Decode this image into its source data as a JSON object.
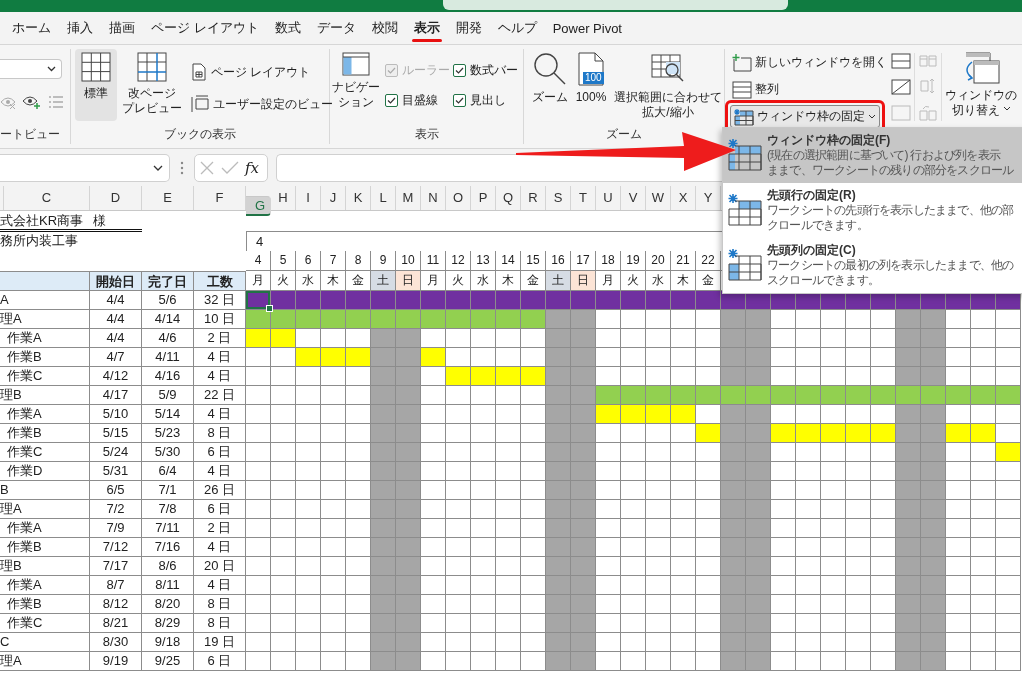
{
  "ribbon_tabs": [
    {
      "label": "ホーム",
      "selected": false
    },
    {
      "label": "挿入",
      "selected": false
    },
    {
      "label": "描画",
      "selected": false
    },
    {
      "label": "ページ レイアウト",
      "selected": false
    },
    {
      "label": "数式",
      "selected": false
    },
    {
      "label": "データ",
      "selected": false
    },
    {
      "label": "校閲",
      "selected": false
    },
    {
      "label": "表示",
      "selected": true
    },
    {
      "label": "開発",
      "selected": false
    },
    {
      "label": "ヘルプ",
      "selected": false
    },
    {
      "label": "Power Pivot",
      "selected": false
    }
  ],
  "ribbon": {
    "sheet_view": {
      "label": "ートビュー"
    },
    "workbook_views": {
      "label": "ブックの表示",
      "buttons": [
        {
          "kind": "normal",
          "lines": [
            "標準"
          ],
          "selected": true
        },
        {
          "kind": "page-break",
          "lines": [
            "改ページ",
            "プレビュー"
          ],
          "selected": false
        }
      ],
      "small_buttons": [
        {
          "kind": "page-layout",
          "label": "ページ レイアウト"
        },
        {
          "kind": "custom-views",
          "label": "ユーザー設定のビュー"
        }
      ]
    },
    "show": {
      "label": "表示",
      "navigation": [
        "ナビゲー",
        "ション"
      ],
      "checkboxes": [
        {
          "label": "ルーラー",
          "checked": true,
          "disabled": true
        },
        {
          "label": "数式バー",
          "checked": true,
          "disabled": false
        },
        {
          "label": "目盛線",
          "checked": true,
          "disabled": false
        },
        {
          "label": "見出し",
          "checked": true,
          "disabled": false
        }
      ]
    },
    "zoom": {
      "label": "ズーム",
      "buttons": [
        {
          "kind": "zoom",
          "lines": [
            "ズーム"
          ]
        },
        {
          "kind": "hundred",
          "icon_text": "100",
          "lines": [
            "100%"
          ]
        },
        {
          "kind": "fit",
          "lines": [
            "選択範囲に合わせて",
            "拡大/縮小"
          ]
        }
      ]
    },
    "window": {
      "buttons": [
        {
          "kind": "new-window",
          "label": "新しいウィンドウを開く",
          "highlighted": false
        },
        {
          "kind": "arrange",
          "label": "整列",
          "highlighted": false
        },
        {
          "kind": "freeze",
          "label": "ウィンドウ枠の固定",
          "highlighted": true
        }
      ],
      "switch": [
        "ウィンドウの",
        "切り替え"
      ]
    }
  },
  "formula_bar": {
    "function_label": "fx"
  },
  "sheet": {
    "left_columns": [
      "C",
      "D",
      "E",
      "F"
    ],
    "client": "式会社KR商事",
    "honorific": "様",
    "project": "務所内装工事",
    "month": "4",
    "headers": [
      "開始日",
      "完了日",
      "工数"
    ],
    "day_columns": [
      {
        "letter": "G",
        "date": "4",
        "weekday": "月",
        "kind": "weekday",
        "selected": true
      },
      {
        "letter": "H",
        "date": "5",
        "weekday": "火",
        "kind": "weekday",
        "selected": false
      },
      {
        "letter": "I",
        "date": "6",
        "weekday": "水",
        "kind": "weekday",
        "selected": false
      },
      {
        "letter": "J",
        "date": "7",
        "weekday": "木",
        "kind": "weekday",
        "selected": false
      },
      {
        "letter": "K",
        "date": "8",
        "weekday": "金",
        "kind": "weekday",
        "selected": false
      },
      {
        "letter": "L",
        "date": "9",
        "weekday": "土",
        "kind": "saturday",
        "selected": false
      },
      {
        "letter": "M",
        "date": "10",
        "weekday": "日",
        "kind": "sunday",
        "selected": false
      },
      {
        "letter": "N",
        "date": "11",
        "weekday": "月",
        "kind": "weekday",
        "selected": false
      },
      {
        "letter": "O",
        "date": "12",
        "weekday": "火",
        "kind": "weekday",
        "selected": false
      },
      {
        "letter": "P",
        "date": "13",
        "weekday": "水",
        "kind": "weekday",
        "selected": false
      },
      {
        "letter": "Q",
        "date": "14",
        "weekday": "木",
        "kind": "weekday",
        "selected": false
      },
      {
        "letter": "R",
        "date": "15",
        "weekday": "金",
        "kind": "weekday",
        "selected": false
      },
      {
        "letter": "S",
        "date": "16",
        "weekday": "土",
        "kind": "saturday",
        "selected": false
      },
      {
        "letter": "T",
        "date": "17",
        "weekday": "日",
        "kind": "sunday",
        "selected": false
      },
      {
        "letter": "U",
        "date": "18",
        "weekday": "月",
        "kind": "weekday",
        "selected": false
      },
      {
        "letter": "V",
        "date": "19",
        "weekday": "火",
        "kind": "weekday",
        "selected": false
      },
      {
        "letter": "W",
        "date": "20",
        "weekday": "水",
        "kind": "weekday",
        "selected": false
      },
      {
        "letter": "X",
        "date": "21",
        "weekday": "木",
        "kind": "weekday",
        "selected": false
      },
      {
        "letter": "Y",
        "date": "22",
        "weekday": "金",
        "kind": "weekday",
        "selected": false
      },
      {
        "kind": "saturday"
      },
      {
        "kind": "sunday"
      },
      {
        "kind": "weekday"
      },
      {
        "kind": "weekday"
      },
      {
        "kind": "weekday"
      },
      {
        "kind": "weekday"
      },
      {
        "kind": "weekday"
      },
      {
        "kind": "saturday"
      },
      {
        "kind": "sunday"
      },
      {
        "kind": "weekday"
      },
      {
        "kind": "weekday"
      },
      {
        "kind": "weekday"
      }
    ],
    "tasks": [
      {
        "name": "A",
        "kind": "phase",
        "start": "4/4",
        "end": "5/6",
        "days": "32 日",
        "selected": true,
        "cells": [
          {
            "color": "#7030a0"
          },
          {
            "color": "#7030a0"
          },
          {
            "color": "#7030a0"
          },
          {
            "color": "#7030a0"
          },
          {
            "color": "#7030a0"
          },
          {
            "color": "#7030a0"
          },
          {
            "color": "#7030a0"
          },
          {
            "color": "#7030a0"
          },
          {
            "color": "#7030a0"
          },
          {
            "color": "#7030a0"
          },
          {
            "color": "#7030a0"
          },
          {
            "color": "#7030a0"
          },
          {
            "color": "#7030a0"
          },
          {
            "color": "#7030a0"
          },
          {
            "color": "#7030a0"
          },
          {
            "color": "#7030a0"
          },
          {
            "color": "#7030a0"
          },
          {
            "color": "#7030a0"
          },
          {
            "color": "#7030a0"
          },
          {
            "color": "#7030a0"
          },
          {
            "color": "#7030a0"
          },
          {
            "color": "#7030a0"
          },
          {
            "color": "#7030a0"
          },
          {
            "color": "#7030a0"
          },
          {
            "color": "#7030a0"
          },
          {
            "color": "#7030a0"
          },
          {
            "color": "#7030a0"
          },
          {
            "color": "#7030a0"
          },
          {
            "color": "#7030a0"
          },
          {
            "color": "#7030a0"
          },
          {
            "color": "#7030a0"
          }
        ]
      },
      {
        "name": "理A",
        "kind": "phase",
        "start": "4/4",
        "end": "4/14",
        "days": "10 日",
        "selected": false,
        "cells": [
          {
            "color": "#92d050"
          },
          {
            "color": "#92d050"
          },
          {
            "color": "#92d050"
          },
          {
            "color": "#92d050"
          },
          {
            "color": "#92d050"
          },
          {
            "color": "#92d050"
          },
          {
            "color": "#92d050"
          },
          {
            "color": "#92d050"
          },
          {
            "color": "#92d050"
          },
          {
            "color": "#92d050"
          },
          {
            "color": "#92d050"
          },
          {
            "color": "#92d050"
          },
          {
            "color": "#a6a6a6"
          },
          {
            "color": "#a6a6a6"
          },
          {
            "color": "#ffffff"
          },
          {
            "color": "#ffffff"
          },
          {
            "color": "#ffffff"
          },
          {
            "color": "#ffffff"
          },
          {
            "color": "#ffffff"
          },
          {
            "color": "#a6a6a6"
          },
          {
            "color": "#a6a6a6"
          },
          {
            "color": "#ffffff"
          },
          {
            "color": "#ffffff"
          },
          {
            "color": "#ffffff"
          },
          {
            "color": "#ffffff"
          },
          {
            "color": "#ffffff"
          },
          {
            "color": "#a6a6a6"
          },
          {
            "color": "#a6a6a6"
          },
          {
            "color": "#ffffff"
          },
          {
            "color": "#ffffff"
          },
          {
            "color": "#ffffff"
          }
        ]
      },
      {
        "name": "作業A",
        "kind": "step",
        "start": "4/4",
        "end": "4/6",
        "days": "2 日",
        "selected": false,
        "cells": [
          {
            "color": "#ffff00"
          },
          {
            "color": "#ffff00"
          },
          {
            "color": "#ffffff"
          },
          {
            "color": "#ffffff"
          },
          {
            "color": "#ffffff"
          },
          {
            "color": "#a6a6a6"
          },
          {
            "color": "#a6a6a6"
          },
          {
            "color": "#ffffff"
          },
          {
            "color": "#ffffff"
          },
          {
            "color": "#ffffff"
          },
          {
            "color": "#ffffff"
          },
          {
            "color": "#ffffff"
          },
          {
            "color": "#a6a6a6"
          },
          {
            "color": "#a6a6a6"
          },
          {
            "color": "#ffffff"
          },
          {
            "color": "#ffffff"
          },
          {
            "color": "#ffffff"
          },
          {
            "color": "#ffffff"
          },
          {
            "color": "#ffffff"
          },
          {
            "color": "#a6a6a6"
          },
          {
            "color": "#a6a6a6"
          },
          {
            "color": "#ffffff"
          },
          {
            "color": "#ffffff"
          },
          {
            "color": "#ffffff"
          },
          {
            "color": "#ffffff"
          },
          {
            "color": "#ffffff"
          },
          {
            "color": "#a6a6a6"
          },
          {
            "color": "#a6a6a6"
          },
          {
            "color": "#ffffff"
          },
          {
            "color": "#ffffff"
          },
          {
            "color": "#ffffff"
          }
        ]
      },
      {
        "name": "作業B",
        "kind": "step",
        "start": "4/7",
        "end": "4/11",
        "days": "4 日",
        "selected": false,
        "cells": [
          {
            "color": "#ffffff"
          },
          {
            "color": "#ffffff"
          },
          {
            "color": "#ffff00"
          },
          {
            "color": "#ffff00"
          },
          {
            "color": "#ffff00"
          },
          {
            "color": "#a6a6a6"
          },
          {
            "color": "#a6a6a6"
          },
          {
            "color": "#ffff00"
          },
          {
            "color": "#ffffff"
          },
          {
            "color": "#ffffff"
          },
          {
            "color": "#ffffff"
          },
          {
            "color": "#ffffff"
          },
          {
            "color": "#a6a6a6"
          },
          {
            "color": "#a6a6a6"
          },
          {
            "color": "#ffffff"
          },
          {
            "color": "#ffffff"
          },
          {
            "color": "#ffffff"
          },
          {
            "color": "#ffffff"
          },
          {
            "color": "#ffffff"
          },
          {
            "color": "#a6a6a6"
          },
          {
            "color": "#a6a6a6"
          },
          {
            "color": "#ffffff"
          },
          {
            "color": "#ffffff"
          },
          {
            "color": "#ffffff"
          },
          {
            "color": "#ffffff"
          },
          {
            "color": "#ffffff"
          },
          {
            "color": "#a6a6a6"
          },
          {
            "color": "#a6a6a6"
          },
          {
            "color": "#ffffff"
          },
          {
            "color": "#ffffff"
          },
          {
            "color": "#ffffff"
          }
        ]
      },
      {
        "name": "作業C",
        "kind": "step",
        "start": "4/12",
        "end": "4/16",
        "days": "4 日",
        "selected": false,
        "cells": [
          {
            "color": "#ffffff"
          },
          {
            "color": "#ffffff"
          },
          {
            "color": "#ffffff"
          },
          {
            "color": "#ffffff"
          },
          {
            "color": "#ffffff"
          },
          {
            "color": "#a6a6a6"
          },
          {
            "color": "#a6a6a6"
          },
          {
            "color": "#ffffff"
          },
          {
            "color": "#ffff00"
          },
          {
            "color": "#ffff00"
          },
          {
            "color": "#ffff00"
          },
          {
            "color": "#ffff00"
          },
          {
            "color": "#a6a6a6"
          },
          {
            "color": "#a6a6a6"
          },
          {
            "color": "#ffffff"
          },
          {
            "color": "#ffffff"
          },
          {
            "color": "#ffffff"
          },
          {
            "color": "#ffffff"
          },
          {
            "color": "#ffffff"
          },
          {
            "color": "#a6a6a6"
          },
          {
            "color": "#a6a6a6"
          },
          {
            "color": "#ffffff"
          },
          {
            "color": "#ffffff"
          },
          {
            "color": "#ffffff"
          },
          {
            "color": "#ffffff"
          },
          {
            "color": "#ffffff"
          },
          {
            "color": "#a6a6a6"
          },
          {
            "color": "#a6a6a6"
          },
          {
            "color": "#ffffff"
          },
          {
            "color": "#ffffff"
          },
          {
            "color": "#ffffff"
          }
        ]
      },
      {
        "name": "理B",
        "kind": "phase",
        "start": "4/17",
        "end": "5/9",
        "days": "22 日",
        "selected": false,
        "cells": [
          {
            "color": "#ffffff"
          },
          {
            "color": "#ffffff"
          },
          {
            "color": "#ffffff"
          },
          {
            "color": "#ffffff"
          },
          {
            "color": "#ffffff"
          },
          {
            "color": "#a6a6a6"
          },
          {
            "color": "#a6a6a6"
          },
          {
            "color": "#ffffff"
          },
          {
            "color": "#ffffff"
          },
          {
            "color": "#ffffff"
          },
          {
            "color": "#ffffff"
          },
          {
            "color": "#ffffff"
          },
          {
            "color": "#a6a6a6"
          },
          {
            "color": "#a6a6a6"
          },
          {
            "color": "#92d050"
          },
          {
            "color": "#92d050"
          },
          {
            "color": "#92d050"
          },
          {
            "color": "#92d050"
          },
          {
            "color": "#92d050"
          },
          {
            "color": "#92d050"
          },
          {
            "color": "#92d050"
          },
          {
            "color": "#92d050"
          },
          {
            "color": "#92d050"
          },
          {
            "color": "#92d050"
          },
          {
            "color": "#92d050"
          },
          {
            "color": "#92d050"
          },
          {
            "color": "#92d050"
          },
          {
            "color": "#92d050"
          },
          {
            "color": "#92d050"
          },
          {
            "color": "#92d050"
          },
          {
            "color": "#92d050"
          }
        ]
      },
      {
        "name": "作業A",
        "kind": "step",
        "start": "5/10",
        "end": "5/14",
        "days": "4 日",
        "selected": false,
        "cells": [
          {
            "color": "#ffffff"
          },
          {
            "color": "#ffffff"
          },
          {
            "color": "#ffffff"
          },
          {
            "color": "#ffffff"
          },
          {
            "color": "#ffffff"
          },
          {
            "color": "#a6a6a6"
          },
          {
            "color": "#a6a6a6"
          },
          {
            "color": "#ffffff"
          },
          {
            "color": "#ffffff"
          },
          {
            "color": "#ffffff"
          },
          {
            "color": "#ffffff"
          },
          {
            "color": "#ffffff"
          },
          {
            "color": "#a6a6a6"
          },
          {
            "color": "#a6a6a6"
          },
          {
            "color": "#ffff00"
          },
          {
            "color": "#ffff00"
          },
          {
            "color": "#ffff00"
          },
          {
            "color": "#ffff00"
          },
          {
            "color": "#ffffff"
          },
          {
            "color": "#a6a6a6"
          },
          {
            "color": "#a6a6a6"
          },
          {
            "color": "#ffffff"
          },
          {
            "color": "#ffffff"
          },
          {
            "color": "#ffffff"
          },
          {
            "color": "#ffffff"
          },
          {
            "color": "#ffffff"
          },
          {
            "color": "#a6a6a6"
          },
          {
            "color": "#a6a6a6"
          },
          {
            "color": "#ffffff"
          },
          {
            "color": "#ffffff"
          },
          {
            "color": "#ffffff"
          }
        ]
      },
      {
        "name": "作業B",
        "kind": "step",
        "start": "5/15",
        "end": "5/23",
        "days": "8 日",
        "selected": false,
        "cells": [
          {
            "color": "#ffffff"
          },
          {
            "color": "#ffffff"
          },
          {
            "color": "#ffffff"
          },
          {
            "color": "#ffffff"
          },
          {
            "color": "#ffffff"
          },
          {
            "color": "#a6a6a6"
          },
          {
            "color": "#a6a6a6"
          },
          {
            "color": "#ffffff"
          },
          {
            "color": "#ffffff"
          },
          {
            "color": "#ffffff"
          },
          {
            "color": "#ffffff"
          },
          {
            "color": "#ffffff"
          },
          {
            "color": "#a6a6a6"
          },
          {
            "color": "#a6a6a6"
          },
          {
            "color": "#ffffff"
          },
          {
            "color": "#ffffff"
          },
          {
            "color": "#ffffff"
          },
          {
            "color": "#ffffff"
          },
          {
            "color": "#ffff00"
          },
          {
            "color": "#a6a6a6"
          },
          {
            "color": "#a6a6a6"
          },
          {
            "color": "#ffff00"
          },
          {
            "color": "#ffff00"
          },
          {
            "color": "#ffff00"
          },
          {
            "color": "#ffff00"
          },
          {
            "color": "#ffff00"
          },
          {
            "color": "#a6a6a6"
          },
          {
            "color": "#a6a6a6"
          },
          {
            "color": "#ffff00"
          },
          {
            "color": "#ffff00"
          },
          {
            "color": "#ffffff"
          }
        ]
      },
      {
        "name": "作業C",
        "kind": "step",
        "start": "5/24",
        "end": "5/30",
        "days": "6 日",
        "selected": false,
        "cells": [
          {
            "color": "#ffffff"
          },
          {
            "color": "#ffffff"
          },
          {
            "color": "#ffffff"
          },
          {
            "color": "#ffffff"
          },
          {
            "color": "#ffffff"
          },
          {
            "color": "#a6a6a6"
          },
          {
            "color": "#a6a6a6"
          },
          {
            "color": "#ffffff"
          },
          {
            "color": "#ffffff"
          },
          {
            "color": "#ffffff"
          },
          {
            "color": "#ffffff"
          },
          {
            "color": "#ffffff"
          },
          {
            "color": "#a6a6a6"
          },
          {
            "color": "#a6a6a6"
          },
          {
            "color": "#ffffff"
          },
          {
            "color": "#ffffff"
          },
          {
            "color": "#ffffff"
          },
          {
            "color": "#ffffff"
          },
          {
            "color": "#ffffff"
          },
          {
            "color": "#a6a6a6"
          },
          {
            "color": "#a6a6a6"
          },
          {
            "color": "#ffffff"
          },
          {
            "color": "#ffffff"
          },
          {
            "color": "#ffffff"
          },
          {
            "color": "#ffffff"
          },
          {
            "color": "#ffffff"
          },
          {
            "color": "#a6a6a6"
          },
          {
            "color": "#a6a6a6"
          },
          {
            "color": "#ffffff"
          },
          {
            "color": "#ffffff"
          },
          {
            "color": "#ffff00"
          }
        ]
      },
      {
        "name": "作業D",
        "kind": "step",
        "start": "5/31",
        "end": "6/4",
        "days": "4 日",
        "selected": false
      },
      {
        "name": "B",
        "kind": "phase",
        "start": "6/5",
        "end": "7/1",
        "days": "26 日",
        "selected": false
      },
      {
        "name": "理A",
        "kind": "phase",
        "start": "7/2",
        "end": "7/8",
        "days": "6 日",
        "selected": false
      },
      {
        "name": "作業A",
        "kind": "step",
        "start": "7/9",
        "end": "7/11",
        "days": "2 日",
        "selected": false
      },
      {
        "name": "作業B",
        "kind": "step",
        "start": "7/12",
        "end": "7/16",
        "days": "4 日",
        "selected": false
      },
      {
        "name": "理B",
        "kind": "phase",
        "start": "7/17",
        "end": "8/6",
        "days": "20 日",
        "selected": false
      },
      {
        "name": "作業A",
        "kind": "step",
        "start": "8/7",
        "end": "8/11",
        "days": "4 日",
        "selected": false
      },
      {
        "name": "作業B",
        "kind": "step",
        "start": "8/12",
        "end": "8/20",
        "days": "8 日",
        "selected": false
      },
      {
        "name": "作業C",
        "kind": "step",
        "start": "8/21",
        "end": "8/29",
        "days": "8 日",
        "selected": false
      },
      {
        "name": "C",
        "kind": "phase",
        "start": "8/30",
        "end": "9/18",
        "days": "19 日",
        "selected": false
      },
      {
        "name": "理A",
        "kind": "phase",
        "start": "9/19",
        "end": "9/25",
        "days": "6 日",
        "selected": false
      }
    ]
  },
  "freeze_menu": {
    "items": [
      {
        "kind": "panes",
        "title": "ウィンドウ枠の固定(F)",
        "lines": [
          "(現在の選択範囲に基づいて) 行および列を表示",
          "ままで、ワークシートの残りの部分をスクロール"
        ],
        "selected": true
      },
      {
        "kind": "top-row",
        "title": "先頭行の固定(R)",
        "lines": [
          "ワークシートの先頭行を表示したままで、他の部",
          "クロールできます。"
        ],
        "selected": false
      },
      {
        "kind": "first-column",
        "title": "先頭列の固定(C)",
        "lines": [
          "ワークシートの最初の列を表示したままで、他の",
          "スクロールできます。"
        ],
        "selected": false
      }
    ]
  }
}
